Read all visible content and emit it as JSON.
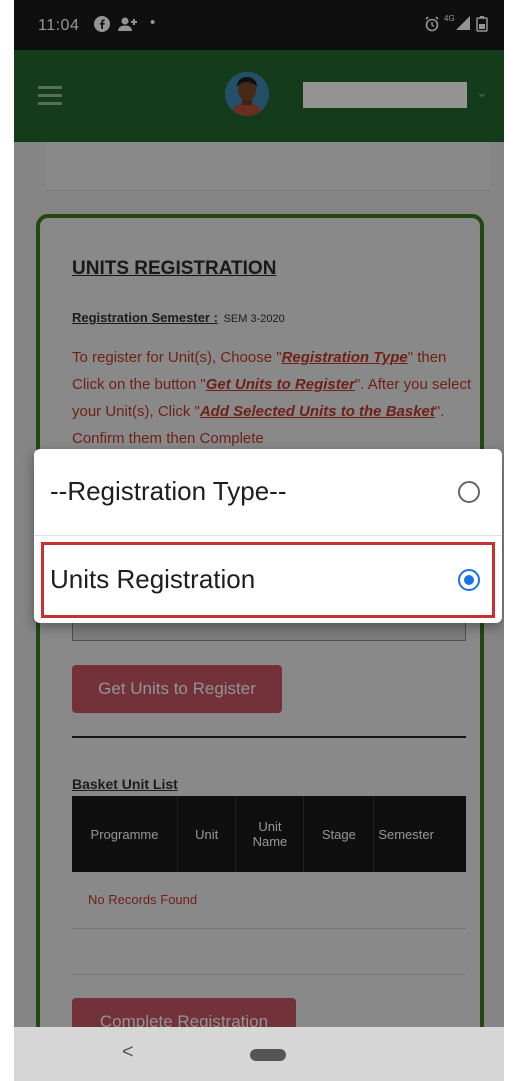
{
  "status_bar": {
    "time": "11:04",
    "icons": [
      "facebook-icon",
      "add-person-icon",
      "dot-icon",
      "alarm-icon",
      "signal-icon",
      "battery-icon"
    ],
    "network": "4G"
  },
  "header": {
    "brand_color": "#23662d"
  },
  "card": {
    "title": "UNITS REGISTRATION",
    "semester_label": "Registration Semester :",
    "semester_value": "SEM 3-2020",
    "instr_1": "To register for Unit(s), Choose \"",
    "instr_em_1": "Registration Type",
    "instr_2": "\" then Click on the button \"",
    "instr_em_2": "Get Units to Register",
    "instr_3": "\". After you select your Unit(s), Click \"",
    "instr_em_3": "Add Selected Units to the Basket",
    "instr_4": "\". Confirm them then Complete"
  },
  "buttons": {
    "get_units": "Get Units to Register",
    "complete": "Complete Registration"
  },
  "basket": {
    "title": "Basket Unit List",
    "columns": [
      "Programme",
      "Unit",
      "Unit Name",
      "Stage",
      "Semester"
    ],
    "empty_text": "No Records Found"
  },
  "dialog": {
    "options": [
      {
        "label": "--Registration Type--",
        "selected": false
      },
      {
        "label": "Units Registration",
        "selected": true
      }
    ]
  },
  "navbar": {
    "back": "<"
  },
  "colors": {
    "accent": "#1a73e8",
    "danger": "#c03e4a",
    "card_border": "#3d7c1f",
    "highlight": "#c8302f"
  }
}
